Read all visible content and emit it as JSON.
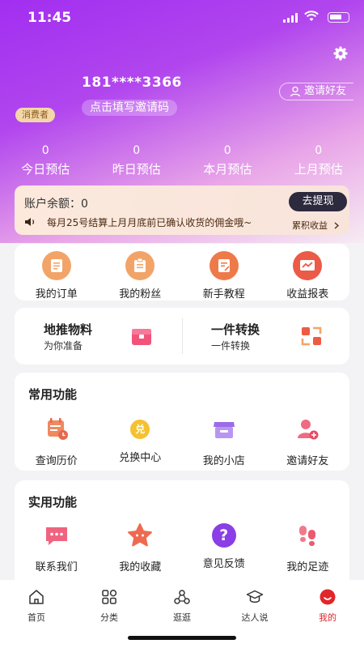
{
  "status_bar": {
    "time": "11:45"
  },
  "profile": {
    "phone": "181****3366",
    "invite_code_prompt": "点击填写邀请码",
    "role_badge": "消费者",
    "invite_friends": "邀请好友"
  },
  "stats": [
    {
      "value": "0",
      "label": "今日预估"
    },
    {
      "value": "0",
      "label": "昨日预估"
    },
    {
      "value": "0",
      "label": "本月预估"
    },
    {
      "value": "0",
      "label": "上月预估"
    }
  ],
  "balance": {
    "label": "账户余额：",
    "amount": "0",
    "withdraw_button": "去提现",
    "notice": "每月25号结算上月月底前已确认收货的佣金哦~",
    "cumulative_link": "累积收益"
  },
  "quick_menu": [
    {
      "label": "我的订单",
      "icon": "order-icon"
    },
    {
      "label": "我的粉丝",
      "icon": "fans-icon"
    },
    {
      "label": "新手教程",
      "icon": "tutorial-icon"
    },
    {
      "label": "收益报表",
      "icon": "report-icon"
    }
  ],
  "promo": {
    "left": {
      "title": "地推物料",
      "subtitle": "为你准备",
      "icon": "box-icon"
    },
    "right": {
      "title": "一件转换",
      "subtitle": "一件转换",
      "icon": "convert-icon"
    }
  },
  "common_functions": {
    "title": "常用功能",
    "items": [
      {
        "label": "查询历价",
        "icon": "price-history-icon"
      },
      {
        "label": "兑换中心",
        "icon": "exchange-icon"
      },
      {
        "label": "我的小店",
        "icon": "shop-icon"
      },
      {
        "label": "邀请好友",
        "icon": "add-user-icon"
      }
    ],
    "exchange_icon_text": "兑"
  },
  "practical_functions": {
    "title": "实用功能",
    "items": [
      {
        "label": "联系我们",
        "icon": "chat-icon"
      },
      {
        "label": "我的收藏",
        "icon": "star-icon"
      },
      {
        "label": "意见反馈",
        "icon": "question-icon"
      },
      {
        "label": "我的足迹",
        "icon": "footprint-icon"
      }
    ],
    "question_icon_text": "?"
  },
  "tabbar": [
    {
      "label": "首页",
      "icon": "home-icon"
    },
    {
      "label": "分类",
      "icon": "category-icon"
    },
    {
      "label": "逛逛",
      "icon": "browse-icon"
    },
    {
      "label": "达人说",
      "icon": "graduation-icon"
    },
    {
      "label": "我的",
      "icon": "profile-icon",
      "active": true
    }
  ],
  "colors": {
    "accent": "#e0262b",
    "hero_start": "#a22ef0",
    "withdraw_button": "#2d2a3e",
    "quick_icon_orange": "#f2a468",
    "report_icon_red": "#ec5a48"
  }
}
